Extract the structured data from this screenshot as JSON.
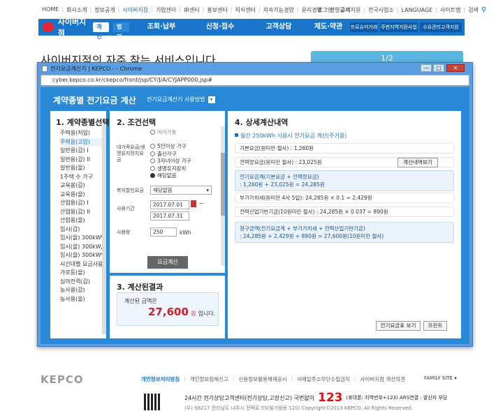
{
  "util": {
    "left_links": [
      "HOME",
      "회사소개",
      "정보공개",
      "사이버지점",
      "기업센터",
      "IR센터",
      "홍보센터",
      "지식센터",
      "지속가능경영",
      "윤리경영",
      "경영공시"
    ],
    "right_links": [
      "로그인",
      "고객지원",
      "전국사업소",
      "LANGUAGE",
      "사이트맵",
      "검색"
    ]
  },
  "nav": {
    "brand": "사이버지점",
    "toggle_personal": "개인",
    "toggle_corp": "법인",
    "items": [
      "조회·납부",
      "신청·접수",
      "고객상담",
      "제도·약관"
    ],
    "buttons": [
      "프로슈머거래",
      "주변지역지원사업",
      "수요관리고객지원"
    ]
  },
  "background": {
    "headline": "사이버지점의 자주 찾는 서비스입니다",
    "banner_page": "1/2"
  },
  "window": {
    "title": "전기요금계산기 | KEPCO - - Chrome",
    "url": "cyber.kepco.co.kr/ckepco/front/jsp/CY/J/A/CYJAPP000.jsp#",
    "min": "—",
    "max": "□",
    "close": "✕"
  },
  "calc": {
    "title": "계약종별 전기요금 계산",
    "guide_link": "전기요금계산기 사용방법",
    "panel1": {
      "title": "1. 계약종별선택",
      "items": [
        "주택용(저압)",
        "주택용(고압)",
        "일반용(갑) I",
        "일반용(갑) II",
        "일반용(을)",
        "1주택 수 가구",
        "교육용(갑)",
        "교육용(을)",
        "산업용(갑) I",
        "산업용(갑) II",
        "산업용(을)",
        "임시(갑)",
        "임시(을) 300kW▼",
        "임시(을) 300kW▲",
        "임시(을) 300kW▼",
        "시간대별 요금사용",
        "가로등(을)",
        "심야전력(갑)",
        "농사용(갑)",
        "농사용(을)"
      ],
      "selected_index": 1
    },
    "panel2": {
      "title": "2. 조건선택",
      "top_partial": "아이가동",
      "big_family_label": "대가족요금/생명유지장치요금",
      "options": [
        "5인이상 가구",
        "출산가구",
        "3자녀이상 가구",
        "생명유지장치",
        "해당없음"
      ],
      "selected_option": 4,
      "welfare_label": "복지할인요금",
      "welfare_value": "해당없음",
      "period_label": "사용기간",
      "date_from": "2017.07.01",
      "date_to": "2017.07.31",
      "usage_label": "사용량",
      "usage_value": "250",
      "usage_unit": "kWh",
      "calc_button": "요금계산"
    },
    "panel3": {
      "title": "3. 계산된결과",
      "text_before": "계산된 금액은",
      "amount": "27,600",
      "unit": "원",
      "text_after": "입니다."
    },
    "panel4": {
      "title": "4. 상세계산내역",
      "subtitle": "월간 250kWh 사용시 전기요금 계산(주거용)",
      "rows": [
        "기본요금(원미만 절사) : 1,260원",
        "전력량요금(원미만 절사) : 23,025원",
        "부가가치세(원미만 4사 5입): 24,285원 × 0.1 = 2,429원",
        "전력산업기반기금(10원미만 절사) : 24,285원 × 0.037 = 890원"
      ],
      "detail_button": "계산내역보기",
      "hi1_line1": "전기요금계(기본요금 + 전력량요금)",
      "hi1_line2": ": 1,260원 + 23,025원 = 24,285원",
      "hi2_line1": "청구금액(전기요금계 + 부가가치세 + 전력산업기반기금)",
      "hi2_line2": ": 24,285원 + 2,429원 + 890원 = 27,600원(10원미만 절사)",
      "table_button": "전기요금표 보기",
      "print_button": "프린트"
    }
  },
  "footer": {
    "logo": "KEPCO",
    "links": [
      "개인정보처리방침",
      "개인정보침해신고",
      "신용정보활용체제공시",
      "이메일주소무단수집금지",
      "사이버지점 개선의견"
    ],
    "family_site": "FAMILY SITE",
    "call_label": "24시간 전기상담고객센터(전기상담,고장신고) 국번없이",
    "call_number": "123",
    "call_note": "(휴대폰: 지역번호+123) ARS연결 : 발신자 부담",
    "address": "(우) 58217 전라남도 나주시 전력로 55(빛가람동 120)   Copyright©2013 KEPCO. All Rights Reserved."
  }
}
